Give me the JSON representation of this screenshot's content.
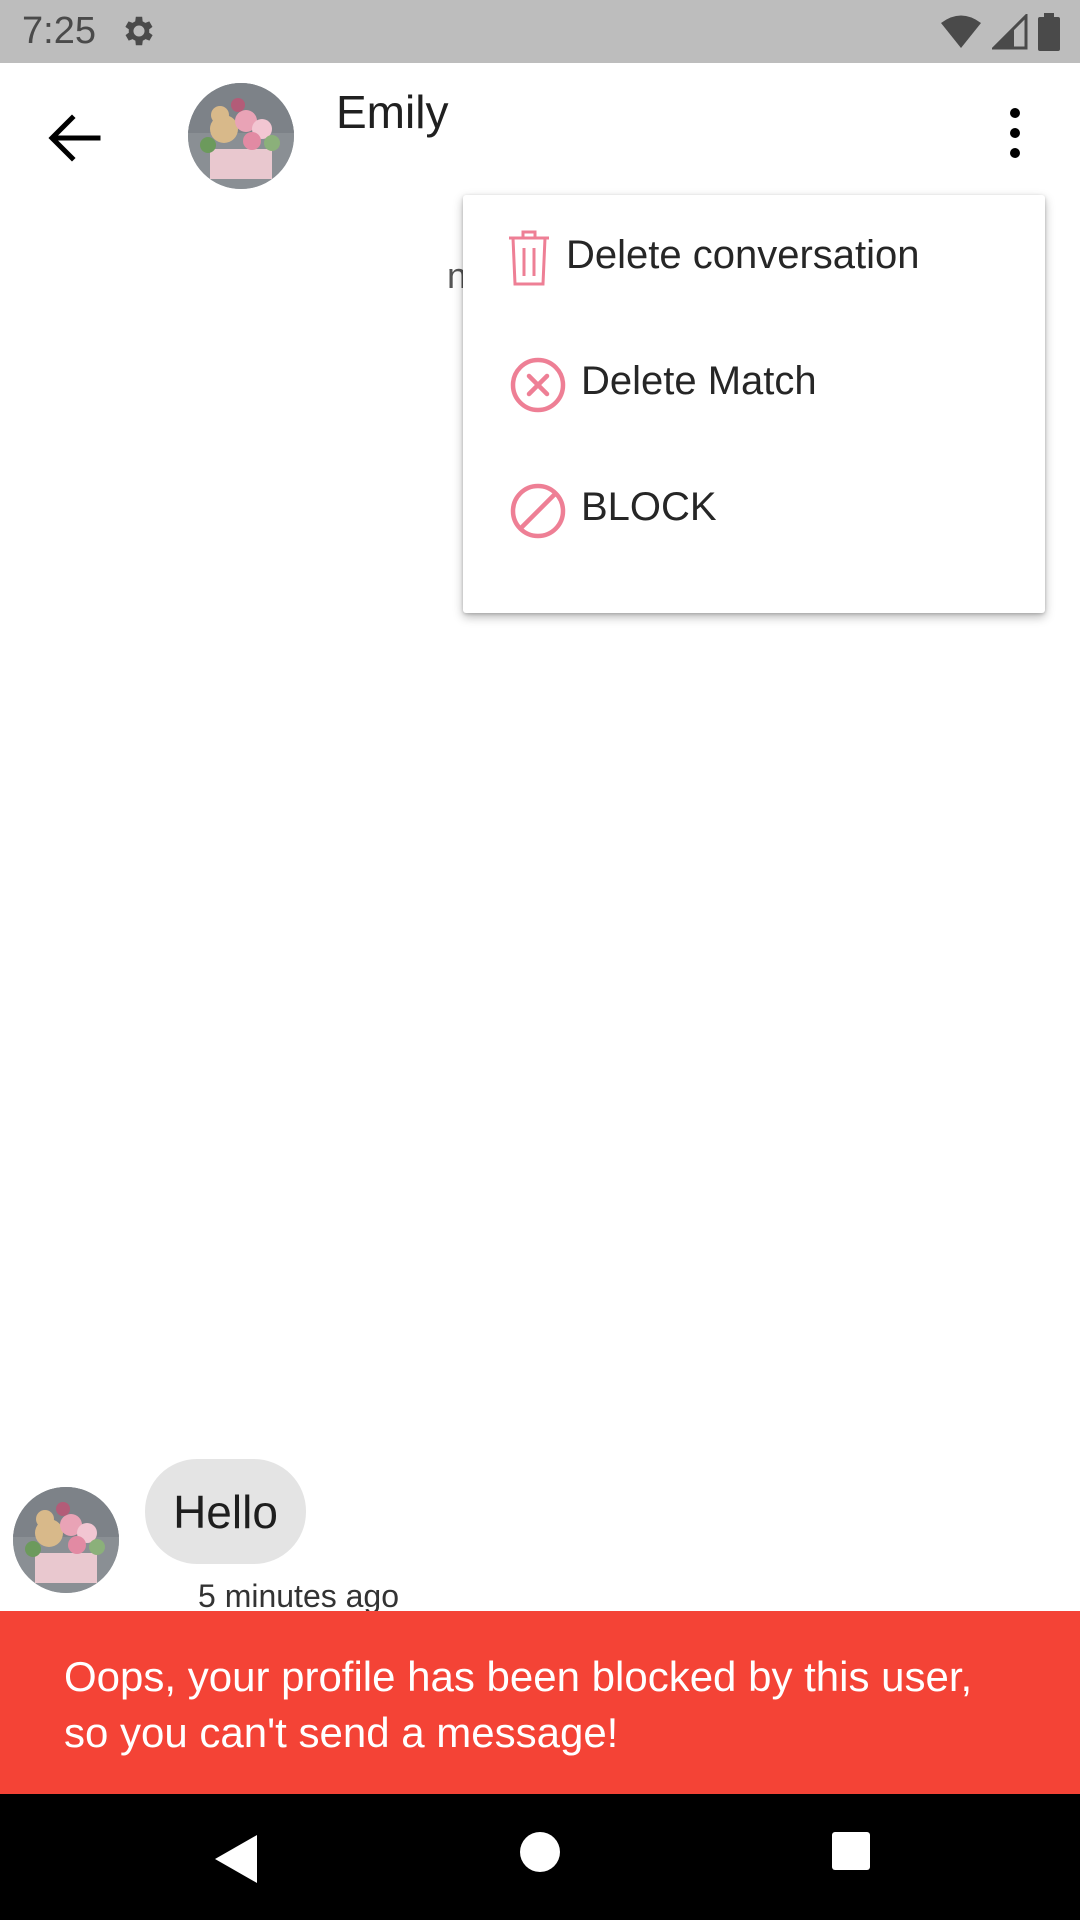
{
  "status_bar": {
    "time": "7:25"
  },
  "header": {
    "contact_name": "Emily"
  },
  "menu": {
    "items": [
      {
        "label": "Delete conversation",
        "icon": "trash-icon"
      },
      {
        "label": "Delete Match",
        "icon": "cancel-circle-icon"
      },
      {
        "label": "BLOCK",
        "icon": "block-icon"
      }
    ],
    "accent_color": "#ee7f95"
  },
  "messages": [
    {
      "text": "Hello",
      "time": "5 minutes ago"
    }
  ],
  "snackbar": {
    "text": "Oops, your profile has been blocked by this user, so you can't send a message!",
    "color": "#f44336"
  }
}
